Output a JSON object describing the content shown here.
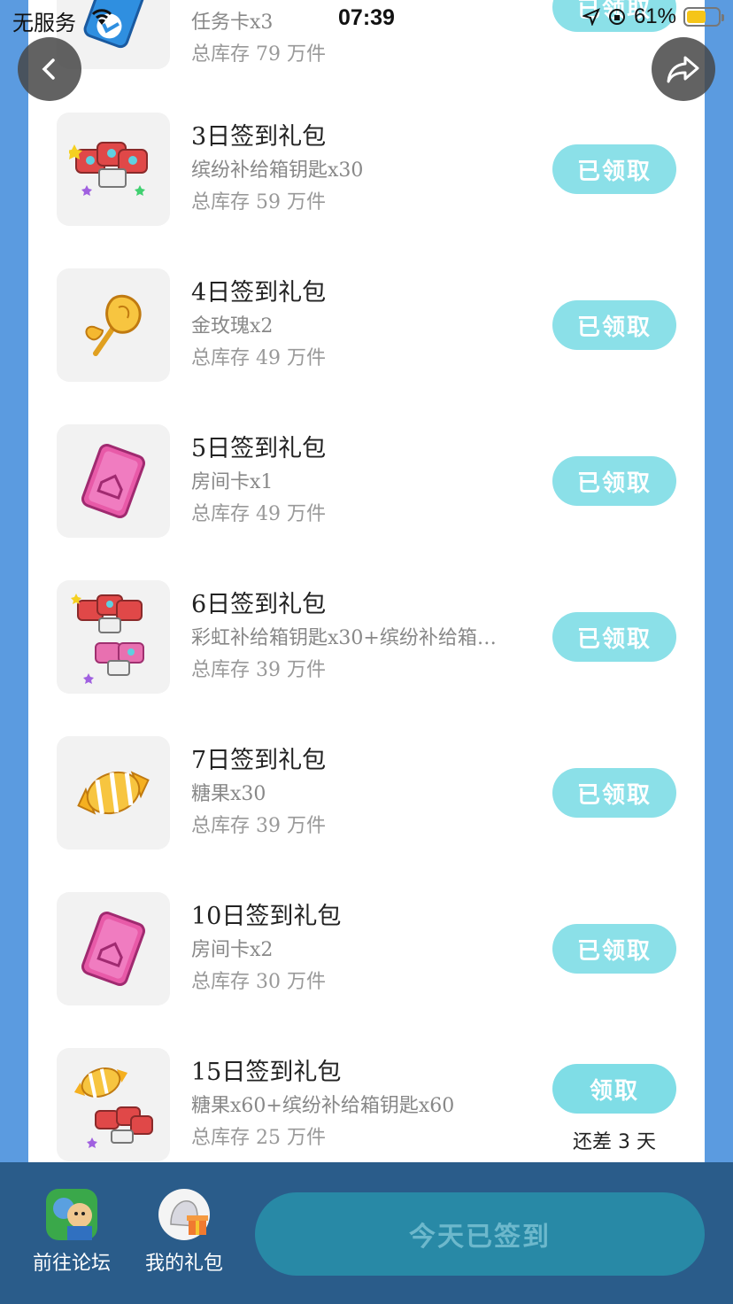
{
  "status_bar": {
    "carrier": "无服务",
    "time": "07:39",
    "battery": "61%",
    "battery_level": 0.61
  },
  "top_partial_row": {
    "desc": "任务卡x3",
    "stock": "总库存 79 万件",
    "button": "已领取"
  },
  "rows": [
    {
      "title": "3日签到礼包",
      "desc": "缤纷补给箱钥匙x30",
      "stock": "总库存 59 万件",
      "button": "已领取",
      "icon": "keys-icon"
    },
    {
      "title": "4日签到礼包",
      "desc": "金玫瑰x2",
      "stock": "总库存 49 万件",
      "button": "已领取",
      "icon": "gold-rose-icon"
    },
    {
      "title": "5日签到礼包",
      "desc": "房间卡x1",
      "stock": "总库存 49 万件",
      "button": "已领取",
      "icon": "room-card-icon"
    },
    {
      "title": "6日签到礼包",
      "desc": "彩虹补给箱钥匙x30+缤纷补给箱…",
      "stock": "总库存 39 万件",
      "button": "已领取",
      "icon": "keys-icon"
    },
    {
      "title": "7日签到礼包",
      "desc": "糖果x30",
      "stock": "总库存 39 万件",
      "button": "已领取",
      "icon": "candy-icon"
    },
    {
      "title": "10日签到礼包",
      "desc": "房间卡x2",
      "stock": "总库存 30 万件",
      "button": "已领取",
      "icon": "room-card-icon"
    },
    {
      "title": "15日签到礼包",
      "desc": "糖果x60+缤纷补给箱钥匙x60",
      "stock": "总库存 25 万件",
      "button": "领取",
      "remaining": "还差 3 天",
      "icon": "candy-keys-icon"
    }
  ],
  "bottom_bar": {
    "forum_label": "前往论坛",
    "gifts_label": "我的礼包",
    "checkin_label": "今天已签到"
  },
  "colors": {
    "background": "#5b9be0",
    "claimed_button": "#8be0e8",
    "bottom_bar": "#2a5c8a",
    "checkin_button": "#2889a6"
  }
}
